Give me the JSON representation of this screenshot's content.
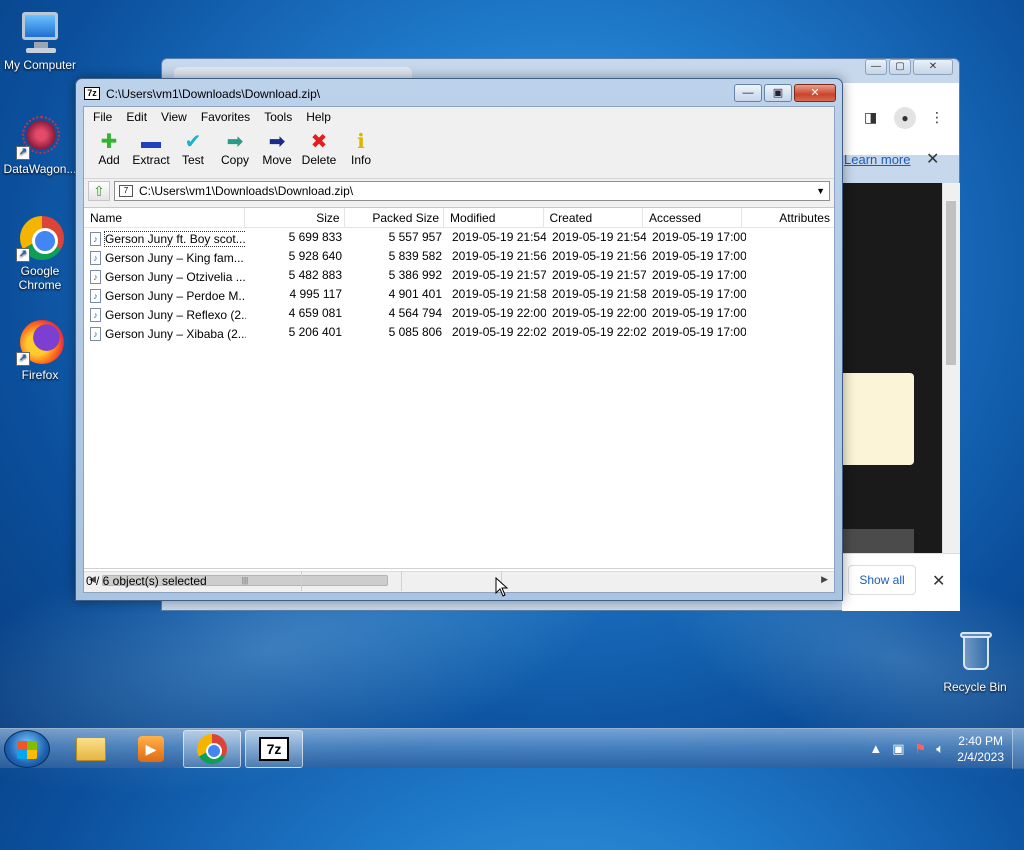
{
  "desktop": {
    "icons": [
      {
        "label": "My Computer"
      },
      {
        "label": "DataWagon..."
      },
      {
        "label": "Google Chrome"
      },
      {
        "label": "Firefox"
      },
      {
        "label": "Recycle Bin"
      }
    ]
  },
  "chrome_window": {
    "learn_more": "Learn more",
    "show_all": "Show all"
  },
  "zip_window": {
    "title": "C:\\Users\\vm1\\Downloads\\Download.zip\\",
    "menu": [
      "File",
      "Edit",
      "View",
      "Favorites",
      "Tools",
      "Help"
    ],
    "toolbar": [
      {
        "label": "Add",
        "icon": "add-icon",
        "color": "#2fb52f"
      },
      {
        "label": "Extract",
        "icon": "extract-icon",
        "color": "#1f3fbf"
      },
      {
        "label": "Test",
        "icon": "test-icon",
        "color": "#19b3c9"
      },
      {
        "label": "Copy",
        "icon": "copy-icon",
        "color": "#2a9a8a"
      },
      {
        "label": "Move",
        "icon": "move-icon",
        "color": "#1a2a8a"
      },
      {
        "label": "Delete",
        "icon": "delete-icon",
        "color": "#e02020"
      },
      {
        "label": "Info",
        "icon": "info-icon",
        "color": "#d9b400"
      }
    ],
    "address": "C:\\Users\\vm1\\Downloads\\Download.zip\\",
    "columns": [
      "Name",
      "Size",
      "Packed Size",
      "Modified",
      "Created",
      "Accessed",
      "Attributes"
    ],
    "rows": [
      {
        "name": "Gerson Juny ft. Boy scot...",
        "size": "5 699 833",
        "packed": "5 557 957",
        "modified": "2019-05-19 21:54",
        "created": "2019-05-19 21:54",
        "accessed": "2019-05-19 17:00"
      },
      {
        "name": "Gerson Juny – King fam...",
        "size": "5 928 640",
        "packed": "5 839 582",
        "modified": "2019-05-19 21:56",
        "created": "2019-05-19 21:56",
        "accessed": "2019-05-19 17:00"
      },
      {
        "name": "Gerson Juny – Otzivelia ...",
        "size": "5 482 883",
        "packed": "5 386 992",
        "modified": "2019-05-19 21:57",
        "created": "2019-05-19 21:57",
        "accessed": "2019-05-19 17:00"
      },
      {
        "name": "Gerson Juny – Perdoe M...",
        "size": "4 995 117",
        "packed": "4 901 401",
        "modified": "2019-05-19 21:58",
        "created": "2019-05-19 21:58",
        "accessed": "2019-05-19 17:00"
      },
      {
        "name": "Gerson Juny – Reflexo (2...",
        "size": "4 659 081",
        "packed": "4 564 794",
        "modified": "2019-05-19 22:00",
        "created": "2019-05-19 22:00",
        "accessed": "2019-05-19 17:00"
      },
      {
        "name": "Gerson Juny – Xibaba (2...",
        "size": "5 206 401",
        "packed": "5 085 806",
        "modified": "2019-05-19 22:02",
        "created": "2019-05-19 22:02",
        "accessed": "2019-05-19 17:00"
      }
    ],
    "status": "0 / 6 object(s) selected"
  },
  "taskbar": {
    "time": "2:40 PM",
    "date": "2/4/2023"
  }
}
